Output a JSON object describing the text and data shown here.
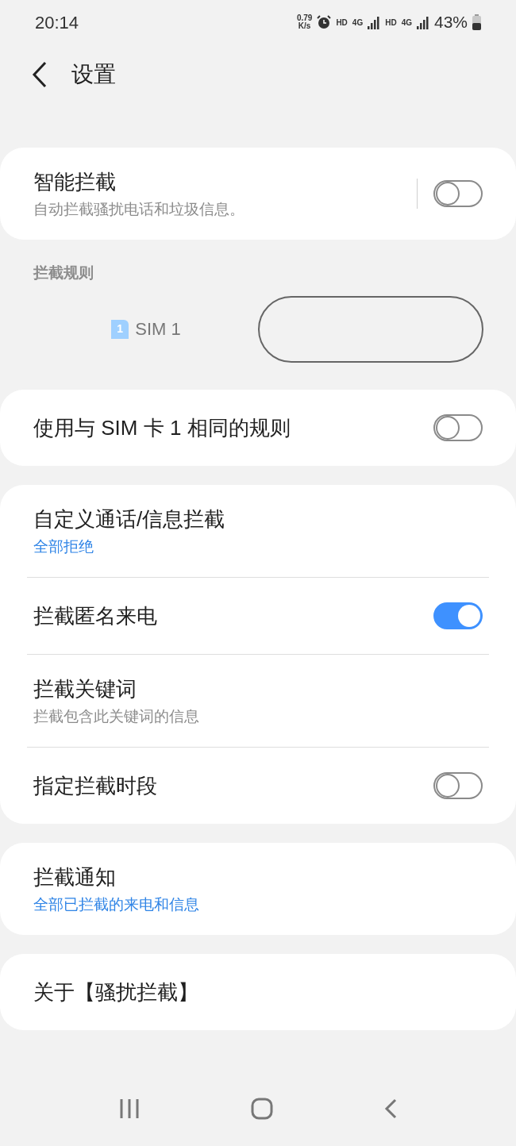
{
  "status_bar": {
    "time": "20:14",
    "speed": "0.79",
    "speed_unit": "K/s",
    "net1": "HD",
    "net1_type": "4G",
    "net2": "HD",
    "net2_type": "4G",
    "battery": "43%"
  },
  "header": {
    "title": "设置"
  },
  "groups": [
    {
      "items": [
        {
          "title": "智能拦截",
          "subtitle": "自动拦截骚扰电话和垃圾信息。",
          "subtitle_highlighted": false,
          "switch": {
            "on": false
          },
          "divider": true
        }
      ]
    },
    {
      "kind": "section",
      "label": "拦截规则",
      "sim_tabs": [
        {
          "label": "SIM 1",
          "badge": "1",
          "selected": false
        },
        {
          "selected": true
        }
      ]
    },
    {
      "items": [
        {
          "title": "使用与 SIM 卡 1 相同的规则",
          "switch": {
            "on": false
          }
        }
      ]
    },
    {
      "items": [
        {
          "title": "自定义通话/信息拦截",
          "subtitle": "全部拒绝",
          "subtitle_highlighted": true
        },
        {
          "title": "拦截匿名来电",
          "switch": {
            "on": true
          }
        },
        {
          "title": "拦截关键词",
          "subtitle": "拦截包含此关键词的信息",
          "subtitle_highlighted": false
        },
        {
          "title": "指定拦截时段",
          "switch": {
            "on": false
          }
        }
      ]
    },
    {
      "items": [
        {
          "title": "拦截通知",
          "subtitle": "全部已拦截的来电和信息",
          "subtitle_highlighted": true
        }
      ]
    },
    {
      "items": [
        {
          "title": "关于【骚扰拦截】"
        }
      ]
    }
  ]
}
